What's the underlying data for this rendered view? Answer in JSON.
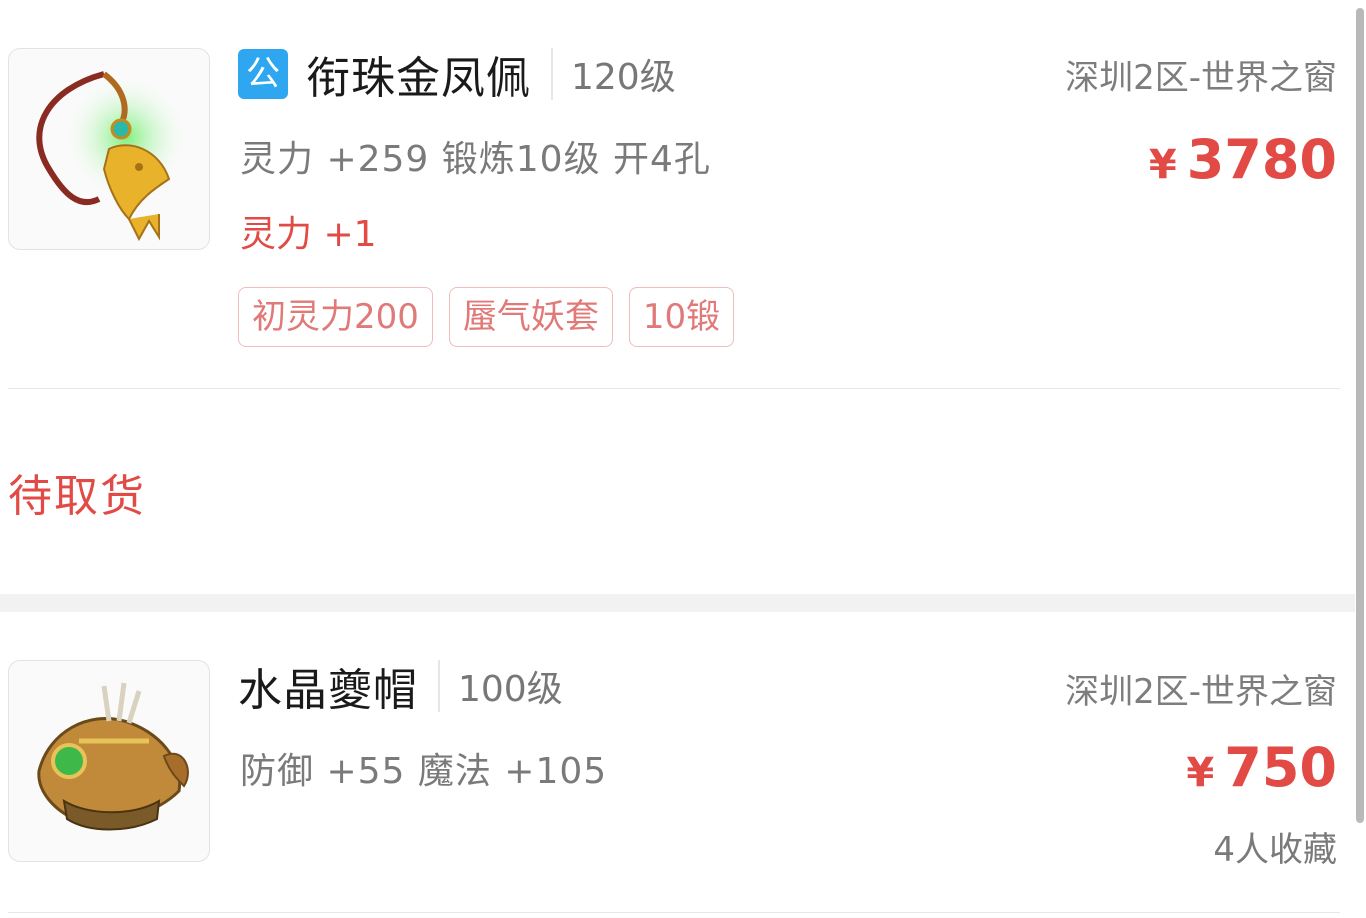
{
  "listings": [
    {
      "public_badge": "公",
      "name": "衔珠金凤佩",
      "level": "120级",
      "server": "深圳2区-世界之窗",
      "price_symbol": "¥",
      "price": "3780",
      "attributes": "灵力 +259 锻炼10级 开4孔",
      "bonus": "灵力 +1",
      "tags": [
        "初灵力200",
        "蜃气妖套",
        "10锻"
      ],
      "icon": "phoenix-pendant-icon",
      "status": "待取货"
    },
    {
      "name": "水晶夔帽",
      "level": "100级",
      "server": "深圳2区-世界之窗",
      "price_symbol": "¥",
      "price": "750",
      "attributes": "防御 +55 魔法 +105",
      "favorites": "4人收藏",
      "icon": "crystal-helmet-icon"
    }
  ],
  "colors": {
    "accent_red": "#e24a45",
    "badge_blue": "#2fa6f0",
    "tag_border": "#f0bcbc"
  }
}
